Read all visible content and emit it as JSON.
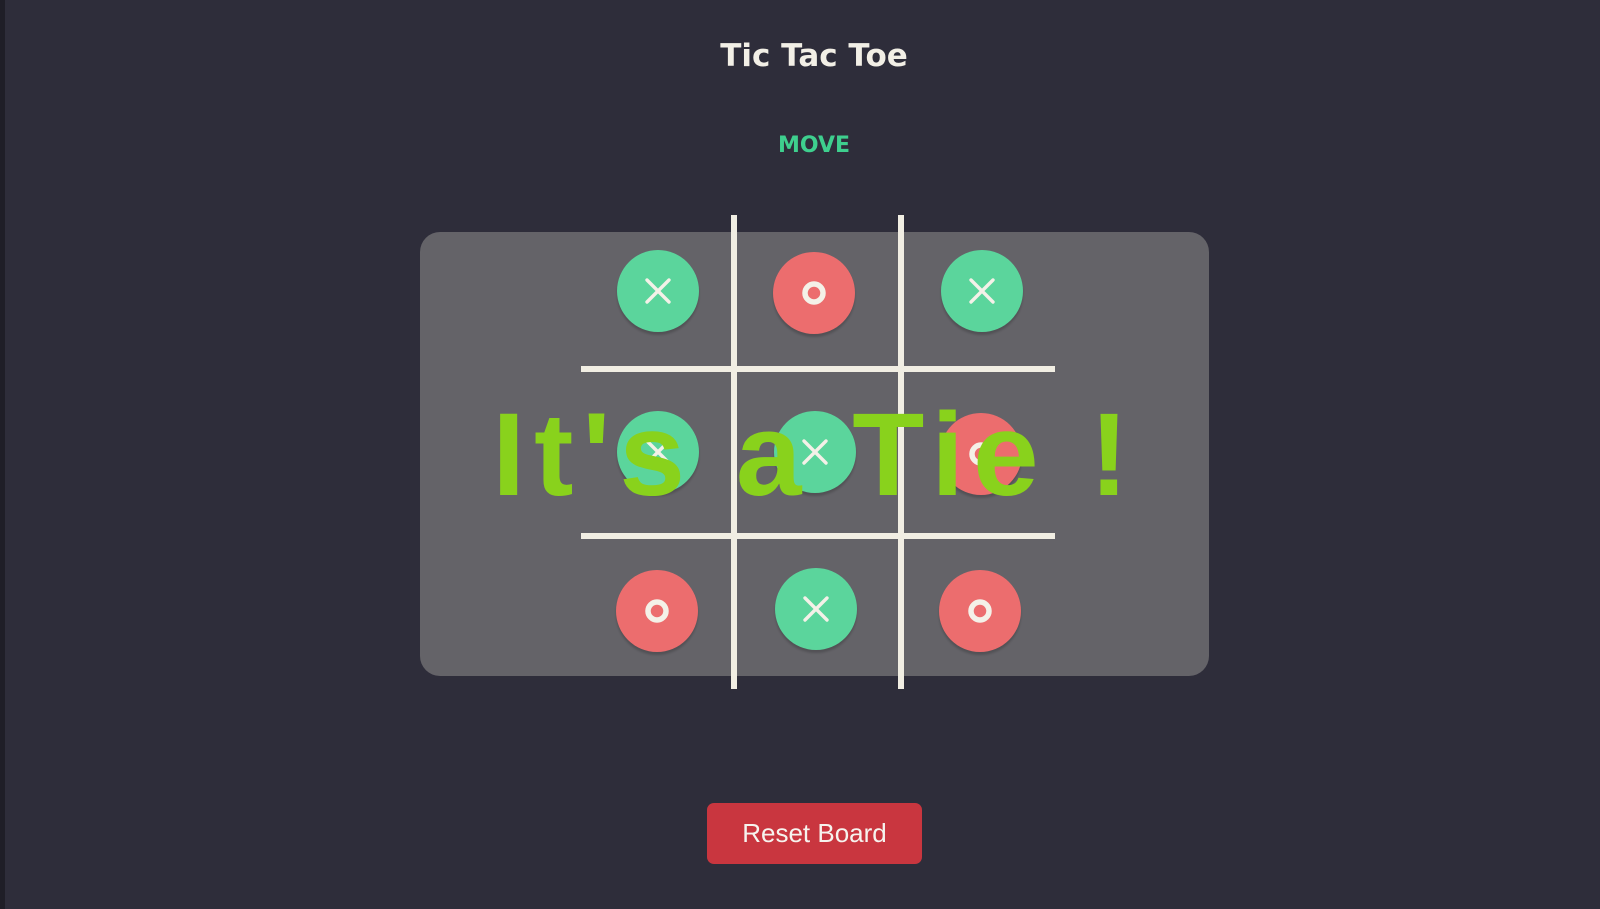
{
  "game": {
    "title": "Tic Tac Toe",
    "status_label": "MOVE",
    "result_message": "It's a Tie !",
    "reset_label": "Reset Board"
  },
  "board": {
    "cells": [
      "X",
      "O",
      "X",
      "X",
      "X",
      "O",
      "O",
      "X",
      "O"
    ]
  },
  "colors": {
    "background": "#2e2d3a",
    "x_piece": "#5bd59c",
    "o_piece": "#ec6d6e",
    "grid_line": "#f1eee3",
    "status_text": "#3ecf8e",
    "tie_text": "#89d21c",
    "reset_button": "#c9363f"
  },
  "icons": {
    "x": "x-mark-icon",
    "o": "o-ring-icon"
  }
}
